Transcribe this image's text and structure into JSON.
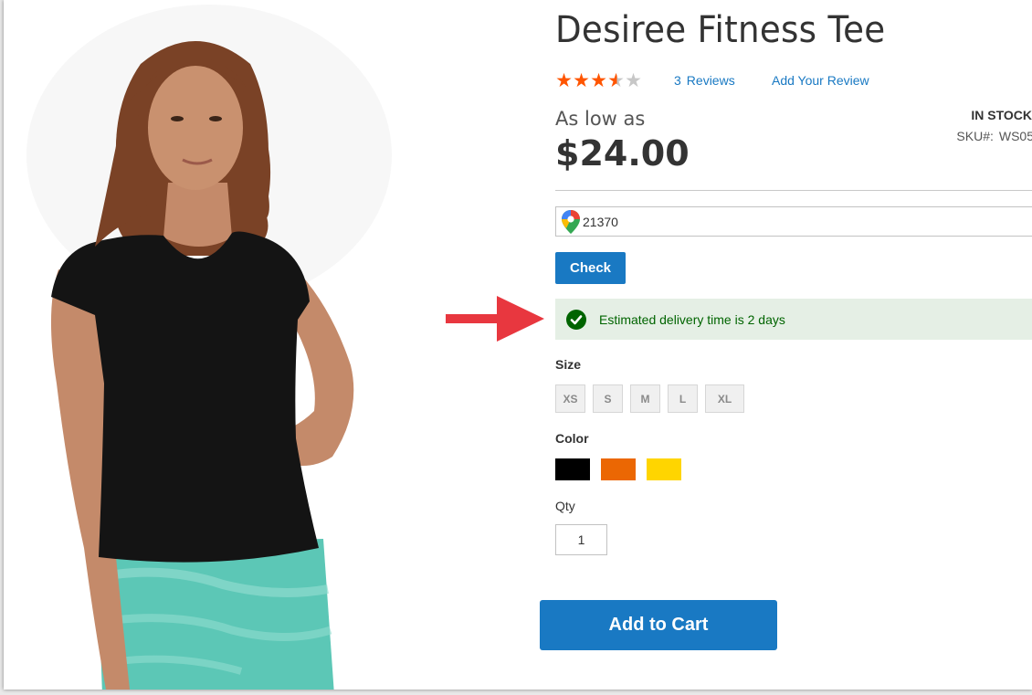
{
  "product": {
    "title": "Desiree Fitness Tee",
    "rating_fraction": 0.7,
    "reviews_count": "3",
    "reviews_label": "Reviews",
    "add_review_label": "Add Your Review",
    "price_prefix": "As low as",
    "price": "$24.00",
    "stock": "IN STOCK",
    "sku_label": "SKU#:",
    "sku_value": "WS05"
  },
  "delivery": {
    "zip_value": "21370",
    "check_label": "Check",
    "message": "Estimated delivery time is 2 days"
  },
  "options": {
    "size_label": "Size",
    "sizes": [
      "XS",
      "S",
      "M",
      "L",
      "XL"
    ],
    "color_label": "Color",
    "colors": [
      "#000000",
      "#eb6703",
      "#ffd500"
    ],
    "qty_label": "Qty",
    "qty_value": "1"
  },
  "cart": {
    "add_label": "Add to Cart"
  },
  "theme": {
    "accent": "#1979c3",
    "star_color": "#ff5501",
    "success_bg": "#e5efe5",
    "success_text": "#006400",
    "arrow_color": "#e8373f"
  }
}
